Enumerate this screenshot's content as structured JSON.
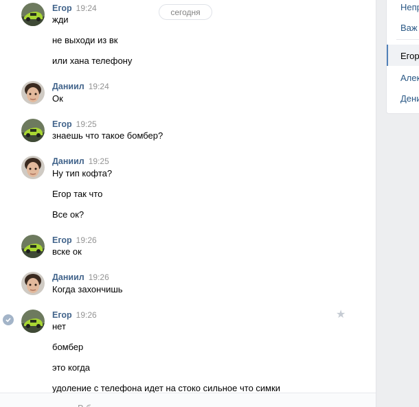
{
  "chat": {
    "date_pill": "сегодня",
    "groups": [
      {
        "author": "Егор",
        "avatar": "car-avatar",
        "time": "19:24",
        "lines": [
          "жди",
          "не выходи из вк",
          "или хана телефону"
        ]
      },
      {
        "author": "Даниил",
        "avatar": "boy-avatar",
        "time": "19:24",
        "lines": [
          "Ок"
        ]
      },
      {
        "author": "Егор",
        "avatar": "car-avatar",
        "time": "19:25",
        "lines": [
          "знаешь что такое бомбер?"
        ]
      },
      {
        "author": "Даниил",
        "avatar": "boy-avatar",
        "time": "19:25",
        "lines": [
          "Ну тип кофта?",
          "Егор так что",
          "Все ок?"
        ]
      },
      {
        "author": "Егор",
        "avatar": "car-avatar",
        "time": "19:26",
        "lines": [
          "вске ок"
        ]
      },
      {
        "author": "Даниил",
        "avatar": "boy-avatar",
        "time": "19:26",
        "lines": [
          "Когда захончишь"
        ]
      },
      {
        "author": "Егор",
        "avatar": "car-avatar",
        "time": "19:26",
        "lines": [
          "нет",
          "бомбер",
          "это когда",
          "удоление с телефона идет на стоко сильное что симки"
        ]
      }
    ]
  },
  "composer": {
    "placeholder": "В                                        б"
  },
  "right_panel": {
    "items": [
      "Непр",
      "Важ",
      "Егор",
      "Алек",
      "Дени"
    ],
    "active_item": "Егор"
  },
  "colors": {
    "author": "#42648b",
    "accent": "#5181b8",
    "link": "#2a5885"
  },
  "icons": {
    "selected_check": "check-circle-icon",
    "favorite": "star-icon"
  }
}
